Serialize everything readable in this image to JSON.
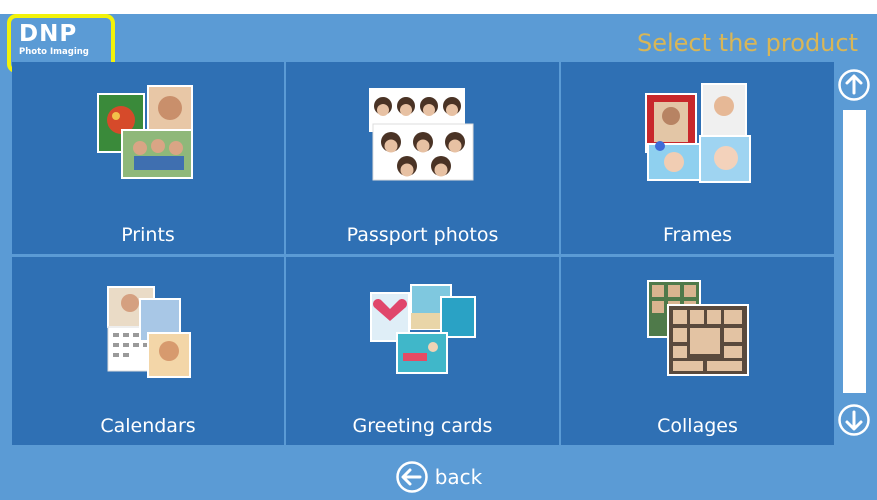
{
  "header": {
    "logo_main": "DNP",
    "logo_sub": "Photo Imaging",
    "title": "Select the product"
  },
  "products": [
    {
      "label": "Prints",
      "icon": "prints-icon"
    },
    {
      "label": "Passport photos",
      "icon": "passport-photos-icon"
    },
    {
      "label": "Frames",
      "icon": "frames-icon"
    },
    {
      "label": "Calendars",
      "icon": "calendars-icon"
    },
    {
      "label": "Greeting cards",
      "icon": "greeting-cards-icon"
    },
    {
      "label": "Collages",
      "icon": "collages-icon"
    }
  ],
  "scroll": {
    "up_icon": "arrow-up-circle-icon",
    "down_icon": "arrow-down-circle-icon"
  },
  "footer": {
    "back_label": "back",
    "back_icon": "arrow-left-circle-icon"
  },
  "colors": {
    "background": "#5b9bd5",
    "tile": "#2f70b4",
    "title": "#e6b94a",
    "logo_highlight": "#f2f20a"
  }
}
